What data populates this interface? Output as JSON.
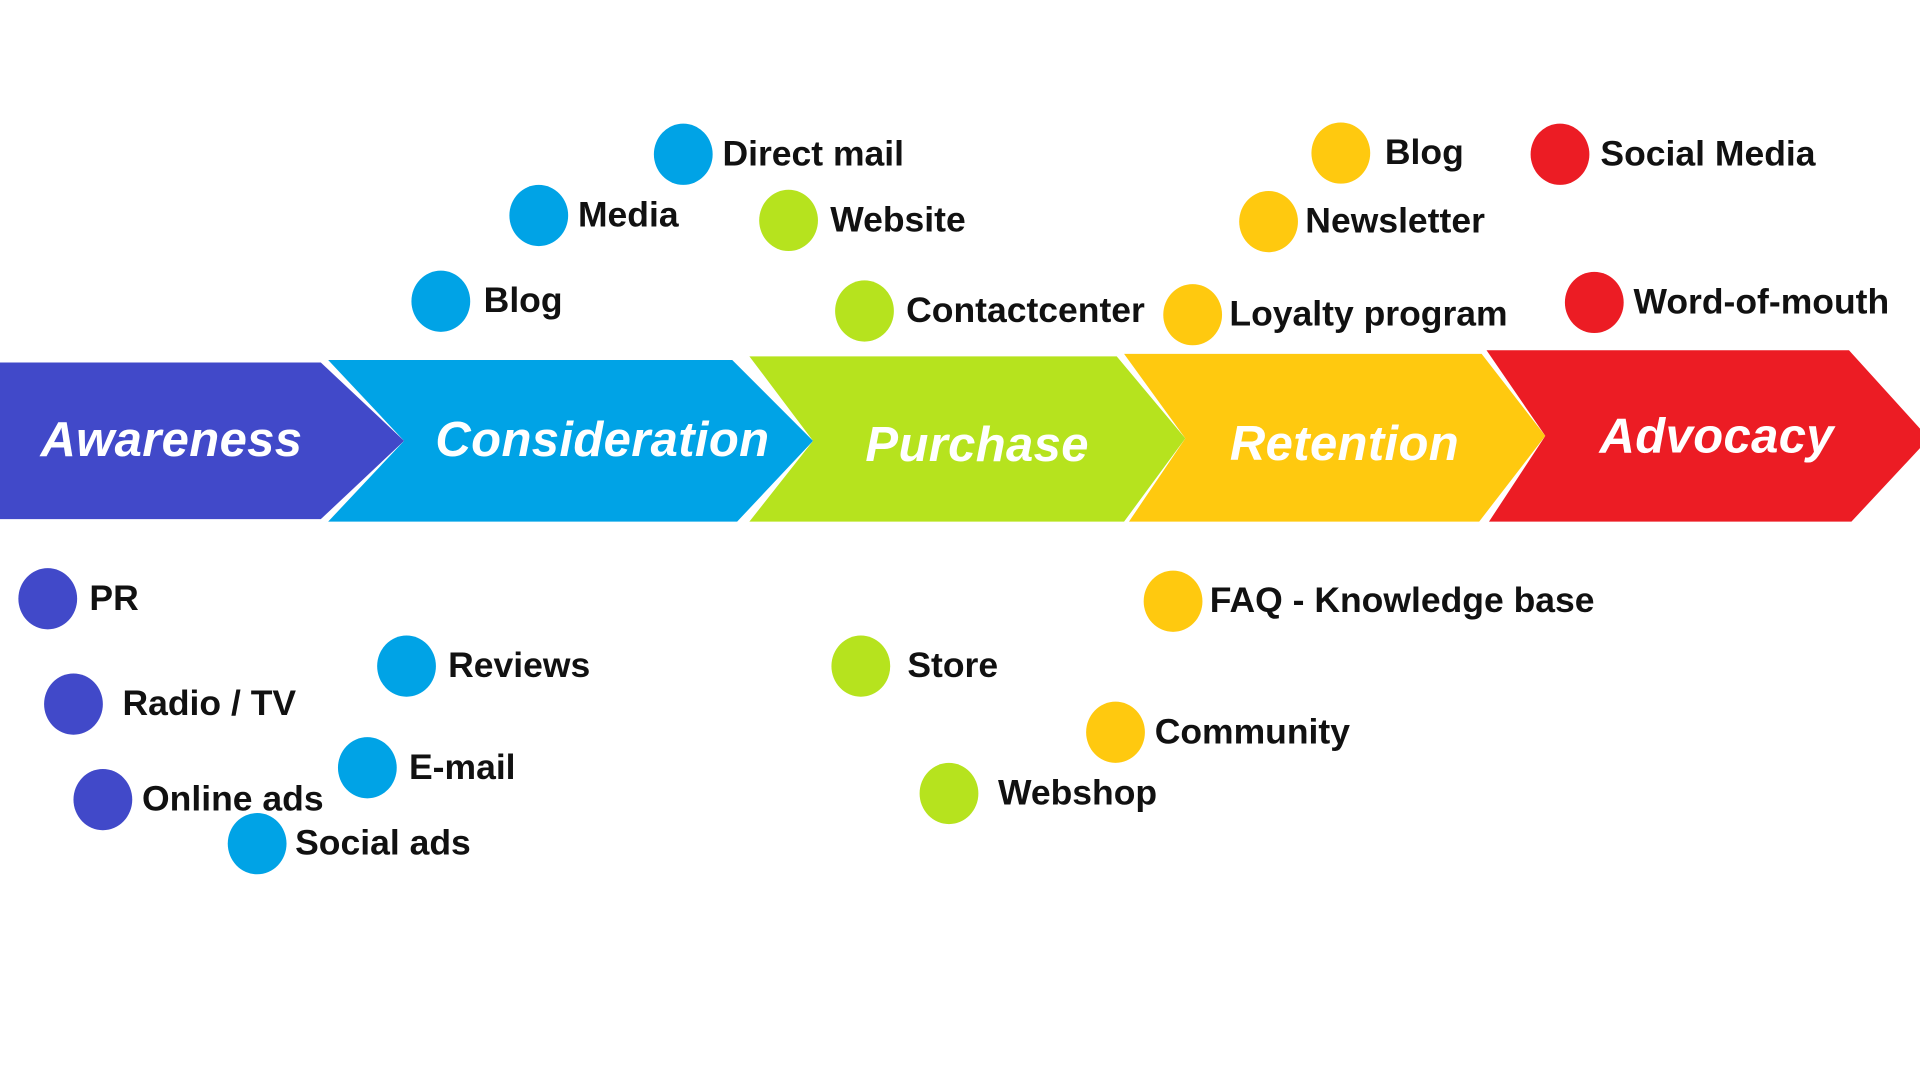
{
  "colors": {
    "awareness": "#4149c9",
    "consideration": "#00a3e6",
    "purchase": "#b6e31e",
    "retention": "#ffc90f",
    "advocacy": "#ec1c24"
  },
  "stages": [
    {
      "id": "awareness",
      "label": "Awareness"
    },
    {
      "id": "consideration",
      "label": "Consideration"
    },
    {
      "id": "purchase",
      "label": "Purchase"
    },
    {
      "id": "retention",
      "label": "Retention"
    },
    {
      "id": "advocacy",
      "label": "Advocacy"
    }
  ],
  "channels": {
    "awareness": [
      "PR",
      "Radio / TV",
      "Online ads"
    ],
    "consideration": [
      "Direct mail",
      "Media",
      "Blog",
      "Reviews",
      "E-mail",
      "Social ads"
    ],
    "purchase": [
      "Website",
      "Contactcenter",
      "Store",
      "Webshop"
    ],
    "retention": [
      "Blog",
      "Newsletter",
      "Loyalty program",
      "FAQ - Knowledge base",
      "Community"
    ],
    "advocacy": [
      "Social Media",
      "Word-of-mouth"
    ]
  }
}
